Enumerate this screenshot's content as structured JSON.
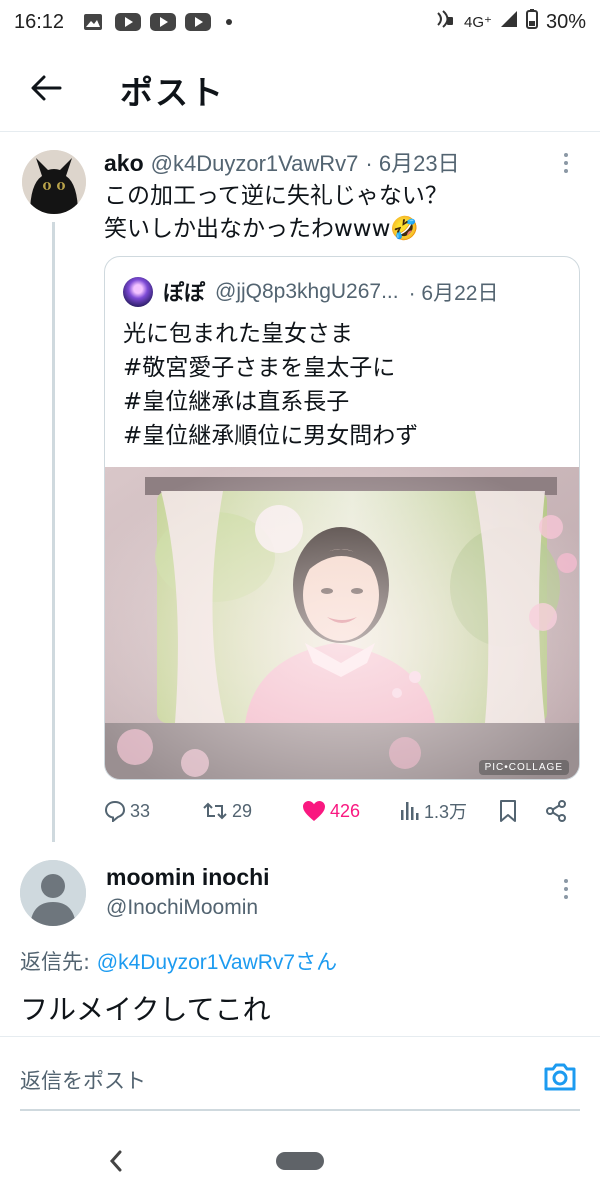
{
  "status_bar": {
    "time": "16:12",
    "network": "4G⁺",
    "battery": "30%"
  },
  "header": {
    "title": "ポスト"
  },
  "tweet": {
    "name": "ako",
    "handle": "@k4Duyzor1VawRv7",
    "date": "· 6月23日",
    "text_line1": "この加工って逆に失礼じゃない？",
    "text_line2": "笑いしか出なかったわwww🤣",
    "quote": {
      "name": "ぽぽ",
      "handle": "@jjQ8p3khgU267...",
      "date": "· 6月22日",
      "lines": [
        "光に包まれた皇女さま",
        "#敬宮愛子さまを皇太子に",
        "#皇位継承は直系長子",
        "#皇位継承順位に男女問わず"
      ],
      "image_watermark": "PIC•COLLAGE"
    },
    "actions": {
      "replies": "33",
      "reposts": "29",
      "likes": "426",
      "views": "1.3万"
    }
  },
  "reply": {
    "name": "moomin inochi",
    "handle": "@InochiMoomin",
    "reply_to_label": "返信先: ",
    "reply_to_mention": "@k4Duyzor1VawRv7さん",
    "text": "フルメイクしてこれ"
  },
  "compose": {
    "placeholder": "返信をポスト"
  },
  "colors": {
    "accent": "#1d9bf0",
    "like": "#f91880",
    "muted": "#536471",
    "border": "#cfd9de"
  }
}
